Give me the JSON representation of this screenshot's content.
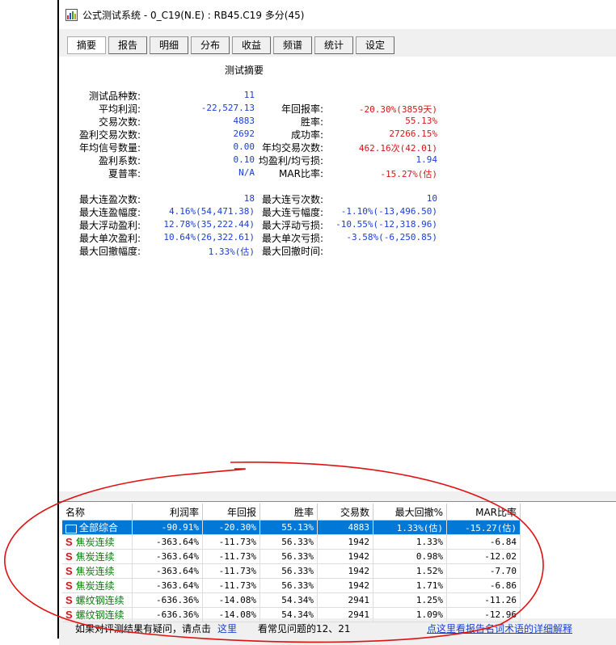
{
  "window": {
    "title": "公式测试系统 - 0_C19(N.E) : RB45.C19 多分(45)"
  },
  "tabs": [
    "摘要",
    "报告",
    "明细",
    "分布",
    "收益",
    "频谱",
    "统计",
    "设定"
  ],
  "summary": {
    "heading": "测试摘要",
    "rows1": [
      {
        "label": "测试品种数:",
        "value": "11"
      },
      {
        "label": "平均利润:",
        "value": "-22,527.13",
        "label2": "年回报率:",
        "value2": "-20.30%(3859天)"
      },
      {
        "label": "交易次数:",
        "value": "4883",
        "label2": "胜率:",
        "value2": "55.13%"
      },
      {
        "label": "盈利交易次数:",
        "value": "2692",
        "label2": "成功率:",
        "value2": "27266.15%"
      },
      {
        "label": "年均信号数量:",
        "value": "0.00",
        "label2": "年均交易次数:",
        "value2": "462.16次(42.01)"
      },
      {
        "label": "盈利系数:",
        "value": "0.10",
        "label2": "均盈利/均亏损:",
        "value2": "1.94"
      },
      {
        "label": "夏普率:",
        "value": "N/A",
        "label2": "MAR比率:",
        "value2": "-15.27%(估)"
      }
    ],
    "rows2": [
      {
        "label": "最大连盈次数:",
        "value": "18",
        "label2": "最大连亏次数:",
        "value2": "10"
      },
      {
        "label": "最大连盈幅度:",
        "value": "4.16%(54,471.38)",
        "label2": "最大连亏幅度:",
        "value2": "-1.10%(-13,496.50)"
      },
      {
        "label": "最大浮动盈利:",
        "value": "12.78%(35,222.44)",
        "label2": "最大浮动亏损:",
        "value2": "-10.55%(-12,318.96)"
      },
      {
        "label": "最大单次盈利:",
        "value": "10.64%(26,322.61)",
        "label2": "最大单次亏损:",
        "value2": "-3.58%(-6,250.85)"
      },
      {
        "label": "最大回撤幅度:",
        "value": "1.33%(估)",
        "label2": "最大回撤时间:",
        "value2": ""
      }
    ]
  },
  "grid": {
    "headers": [
      "名称",
      "利润率",
      "年回报",
      "胜率",
      "交易数",
      "最大回撤%",
      "MAR比率"
    ],
    "rows": [
      {
        "name": "全部综合",
        "profit": "-90.91%",
        "annual": "-20.30%",
        "win": "55.13%",
        "trades": "4883",
        "maxdd": "1.33%(估)",
        "mar": "-15.27(估)"
      },
      {
        "name": "焦炭连续",
        "profit": "-363.64%",
        "annual": "-11.73%",
        "win": "56.33%",
        "trades": "1942",
        "maxdd": "1.33%",
        "mar": "-6.84"
      },
      {
        "name": "焦炭连续",
        "profit": "-363.64%",
        "annual": "-11.73%",
        "win": "56.33%",
        "trades": "1942",
        "maxdd": "0.98%",
        "mar": "-12.02"
      },
      {
        "name": "焦炭连续",
        "profit": "-363.64%",
        "annual": "-11.73%",
        "win": "56.33%",
        "trades": "1942",
        "maxdd": "1.52%",
        "mar": "-7.70"
      },
      {
        "name": "焦炭连续",
        "profit": "-363.64%",
        "annual": "-11.73%",
        "win": "56.33%",
        "trades": "1942",
        "maxdd": "1.71%",
        "mar": "-6.86"
      },
      {
        "name": "螺纹钢连续",
        "profit": "-636.36%",
        "annual": "-14.08%",
        "win": "54.34%",
        "trades": "2941",
        "maxdd": "1.25%",
        "mar": "-11.26"
      },
      {
        "name": "螺纹钢连续",
        "profit": "-636.36%",
        "annual": "-14.08%",
        "win": "54.34%",
        "trades": "2941",
        "maxdd": "1.09%",
        "mar": "-12.96"
      }
    ]
  },
  "status": {
    "prefix": "如果对评测结果有疑问，请点击",
    "link": "这里",
    "suffix": "看常见问题的12、21",
    "right_link": "点这里看报告名词术语的详细解释"
  },
  "colors": {
    "accent": "#0078d7",
    "annotation": "#e01010"
  }
}
